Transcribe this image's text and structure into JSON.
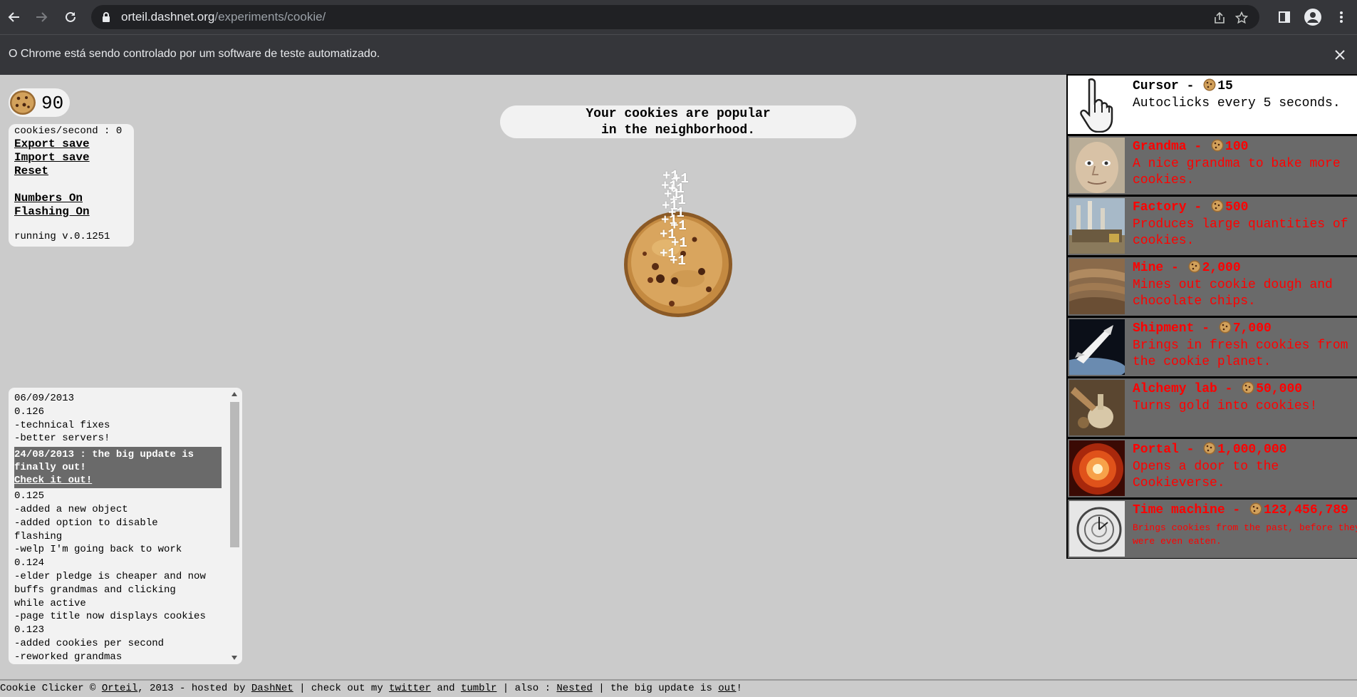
{
  "browser": {
    "url_host": "orteil.dashnet.org",
    "url_path": "/experiments/cookie/",
    "infobar_text": "O Chrome está sendo controlado por um software de teste automatizado."
  },
  "game": {
    "cookies": "90",
    "cps": "cookies/second : 0",
    "links": {
      "export": "Export save",
      "import": "Import save",
      "reset": "Reset",
      "numbers": "Numbers On",
      "flashing": "Flashing On"
    },
    "version": "running v.0.1251",
    "news_line1": "Your cookies are popular",
    "news_line2": "in the neighborhood.",
    "click_popup": "+1"
  },
  "changelog": {
    "before": [
      "06/09/2013",
      "0.126",
      "-technical fixes",
      "-better servers!"
    ],
    "highlight_text": "24/08/2013 : the big update is finally out!",
    "highlight_link": "Check it out!",
    "after": [
      "0.125",
      "-added a new object",
      "-added option to disable",
      "flashing",
      "-welp I'm going back to work",
      "0.124",
      "-elder pledge is cheaper and now",
      "buffs grandmas and clicking",
      "while active",
      "-page title now displays cookies",
      "0.123",
      "-added cookies per second",
      "-reworked grandmas"
    ]
  },
  "store": [
    {
      "name": "Cursor",
      "price": "15",
      "desc": "Autoclicks every 5 seconds.",
      "affordable": true
    },
    {
      "name": "Grandma",
      "price": "100",
      "desc": "A nice grandma to bake more cookies.",
      "affordable": false
    },
    {
      "name": "Factory",
      "price": "500",
      "desc": "Produces large quantities of cookies.",
      "affordable": false
    },
    {
      "name": "Mine",
      "price": "2,000",
      "desc": "Mines out cookie dough and chocolate chips.",
      "affordable": false
    },
    {
      "name": "Shipment",
      "price": "7,000",
      "desc": "Brings in fresh cookies from the cookie planet.",
      "affordable": false
    },
    {
      "name": "Alchemy lab",
      "price": "50,000",
      "desc": "Turns gold into cookies!",
      "affordable": false
    },
    {
      "name": "Portal",
      "price": "1,000,000",
      "desc": "Opens a door to the Cookieverse.",
      "affordable": false
    },
    {
      "name": "Time machine",
      "price": "123,456,789",
      "desc": "Brings cookies from the past, before they were even eaten.",
      "affordable": false
    }
  ],
  "footer": {
    "t1": "Cookie Clicker © ",
    "orteil": "Orteil",
    "t2": ", 2013 - hosted by ",
    "dashnet": "DashNet",
    "t3": " | check out my ",
    "twitter": "twitter",
    "t4": " and ",
    "tumblr": "tumblr",
    "t5": " | also : ",
    "nested": "Nested",
    "t6": " | the big update is ",
    "out": "out",
    "t7": "!"
  }
}
